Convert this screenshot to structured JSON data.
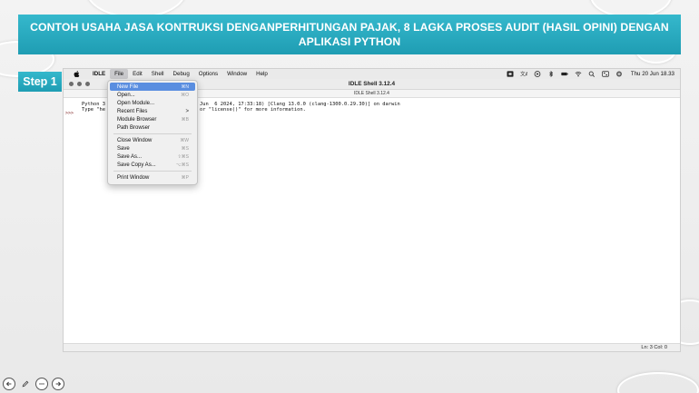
{
  "slide": {
    "title": "CONTOH USAHA JASA KONTRUKSI DENGANPERHITUNGAN PAJAK, 8 LAGKA PROSES AUDIT (HASIL OPINI) DENGAN APLIKASI PYTHON",
    "step_label": "Step 1",
    "accent_color": "#1f9db3"
  },
  "menubar": {
    "app_name": "IDLE",
    "items": [
      "File",
      "Edit",
      "Shell",
      "Debug",
      "Options",
      "Window",
      "Help"
    ],
    "clock": "Thu 20 Jun 18.33"
  },
  "window": {
    "title": "IDLE Shell 3.12.4",
    "subtitle": "IDLE Shell 3.12.4",
    "prompt": ">>>",
    "banner_line1_start": "Python 3",
    "banner_line1_end": "Jun  6 2024, 17:33:18) [Clang 13.0.0 (clang-1300.0.29.30)] on darwin",
    "banner_line2_start": "Type \"he",
    "banner_line2_end": "or \"license()\" for more information.",
    "status": "Ln: 3  Col: 0"
  },
  "file_menu": {
    "items": [
      {
        "label": "New File",
        "shortcut": "⌘N"
      },
      {
        "label": "Open...",
        "shortcut": "⌘O"
      },
      {
        "label": "Open Module...",
        "shortcut": ""
      },
      {
        "label": "Recent Files",
        "shortcut": ">"
      },
      {
        "label": "Module Browser",
        "shortcut": "⌘B"
      },
      {
        "label": "Path Browser",
        "shortcut": ""
      },
      {
        "label": "Close Window",
        "shortcut": "⌘W"
      },
      {
        "label": "Save",
        "shortcut": "⌘S"
      },
      {
        "label": "Save As...",
        "shortcut": "⇧⌘S"
      },
      {
        "label": "Save Copy As...",
        "shortcut": "⌥⌘S"
      },
      {
        "label": "Print Window",
        "shortcut": "⌘P"
      }
    ]
  }
}
